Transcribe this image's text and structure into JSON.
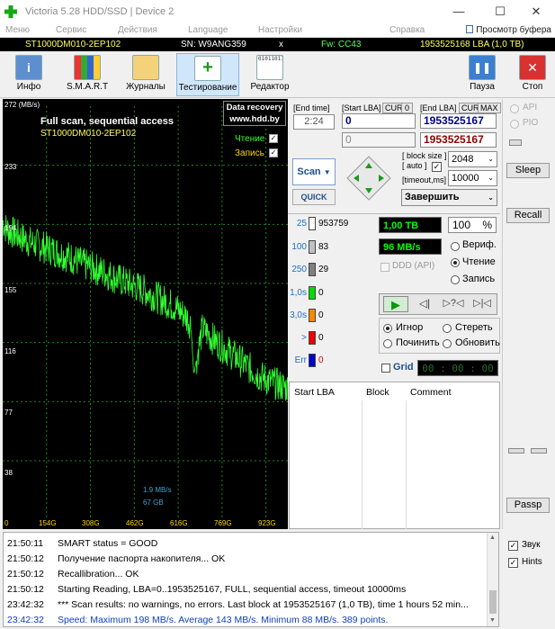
{
  "window": {
    "title": "Victoria 5.28 HDD/SSD | Device 2",
    "minimize": "—",
    "maximize": "☐",
    "close": "✕"
  },
  "menu": {
    "items": [
      "Меню",
      "Сервис",
      "Действия",
      "Language",
      "Настройки",
      "Справка"
    ],
    "clipboard": "Просмотр буфера"
  },
  "device_bar": {
    "model": "ST1000DM010-2EP102",
    "serial": "SN: W9ANG359",
    "x": "x",
    "firmware": "Fw: CC43",
    "capacity": "1953525168 LBA (1,0 TB)"
  },
  "toolbar": {
    "info": "Инфо",
    "smart": "S.M.A.R.T",
    "logs": "Журналы",
    "testing": "Тестирование",
    "editor": "Редактор",
    "pause": "Пауза",
    "stop": "Стоп"
  },
  "graph": {
    "ymax_label": "272 (MB/s)",
    "y_ticks": [
      "233",
      "194",
      "155",
      "116",
      "77",
      "38"
    ],
    "x_ticks": [
      "0",
      "154G",
      "308G",
      "462G",
      "616G",
      "769G",
      "923G"
    ],
    "title": "Full scan, sequential access",
    "model": "ST1000DM010-2EP102",
    "banner_line1": "Data recovery",
    "banner_line2": "www.hdd.by",
    "read_label": "Чтение",
    "write_label": "Запись",
    "cursor_speed": "1.9 MB/s",
    "cursor_pos": "67 GB"
  },
  "chart_data": {
    "type": "line",
    "title": "Full scan, sequential access",
    "ylabel": "(MB/s)",
    "ylim": [
      0,
      272
    ],
    "xlim_gb": [
      0,
      1000
    ],
    "series": [
      {
        "x": [
          0,
          10,
          20,
          40,
          60,
          80,
          100,
          130,
          160,
          200,
          240,
          280,
          320,
          360,
          400,
          440,
          480,
          520,
          560,
          600,
          640,
          660,
          670,
          700,
          740,
          780,
          820,
          860,
          900,
          940,
          970,
          1000
        ],
        "y": [
          196,
          192,
          190,
          188,
          186,
          184,
          182,
          180,
          178,
          175,
          172,
          168,
          165,
          162,
          158,
          155,
          152,
          148,
          144,
          140,
          134,
          128,
          95,
          125,
          118,
          112,
          106,
          100,
          94,
          90,
          88,
          86
        ]
      }
    ]
  },
  "controls": {
    "end_time_label": "End time",
    "end_time": "2:24",
    "start_lba_label": "Start LBA",
    "cur": "CUR",
    "zero": "0",
    "end_lba_label": "End LBA",
    "max": "MAX",
    "start_lba": "0",
    "end_lba": "1953525167",
    "start_lba2": "0",
    "end_lba2": "1953525167",
    "scan_button": "Scan",
    "quick_button": "QUICK",
    "block_size_label": "block size",
    "auto_label": "auto",
    "timeout_label": "timeout,ms",
    "block_size": "2048",
    "timeout": "10000",
    "finish_select": "Завершить"
  },
  "stats": {
    "rows": [
      {
        "label": "25",
        "value": "953759",
        "color": "#ffffff"
      },
      {
        "label": "100",
        "value": "83",
        "color": "#c0c0c0"
      },
      {
        "label": "250",
        "value": "29",
        "color": "#808080"
      },
      {
        "label": "1,0s",
        "value": "0",
        "color": "#00dd00"
      },
      {
        "label": "3,0s",
        "value": "0",
        "color": "#ff8800"
      },
      {
        "label": ">",
        "value": "0",
        "color": "#ee0000"
      },
      {
        "label": "Err",
        "value": "0",
        "color": "#0000cc"
      }
    ],
    "total": "1,00 TB",
    "percent": "100",
    "percent_sign": "%",
    "speed": "96 MB/s",
    "verify": "Вериф.",
    "read": "Чтение",
    "write": "Запись",
    "ddd_api": "DDD (API)"
  },
  "actions": {
    "ignore": "Игнор",
    "erase": "Стереть",
    "repair": "Починить",
    "refresh": "Обновить",
    "grid": "Grid",
    "timer": "00 : 00 : 00"
  },
  "table": {
    "columns": [
      "Start LBA",
      "Block",
      "Comment"
    ]
  },
  "side": {
    "api": "API",
    "pio": "PIO",
    "sleep": "Sleep",
    "recall": "Recall",
    "passp": "Passp",
    "sound": "Звук",
    "hints": "Hints"
  },
  "log": [
    {
      "time": "21:50:11",
      "text": "SMART status = GOOD",
      "color": "#000000"
    },
    {
      "time": "21:50:12",
      "text": "Получение паспорта накопителя... OK",
      "color": "#000000"
    },
    {
      "time": "21:50:12",
      "text": "Recallibration... OK",
      "color": "#000000"
    },
    {
      "time": "21:50:12",
      "text": "Starting Reading, LBA=0..1953525167, FULL, sequential access, timeout 10000ms",
      "color": "#000000"
    },
    {
      "time": "23:42:32",
      "text": "*** Scan results: no warnings, no errors. Last block at 1953525167 (1,0 TB), time 1 hours 52 min...",
      "color": "#000000"
    },
    {
      "time": "23:42:32",
      "text": "Speed: Maximum 198 MB/s. Average 143 MB/s. Minimum 88 MB/s. 389 points.",
      "color": "#1040c0"
    }
  ],
  "colors": {
    "graph_line": "#33ff33",
    "grid": "#1b8a1b",
    "device_fg": "#ffff55",
    "value_box_bg": "#000000",
    "value_box_fg": "#00ff00"
  }
}
